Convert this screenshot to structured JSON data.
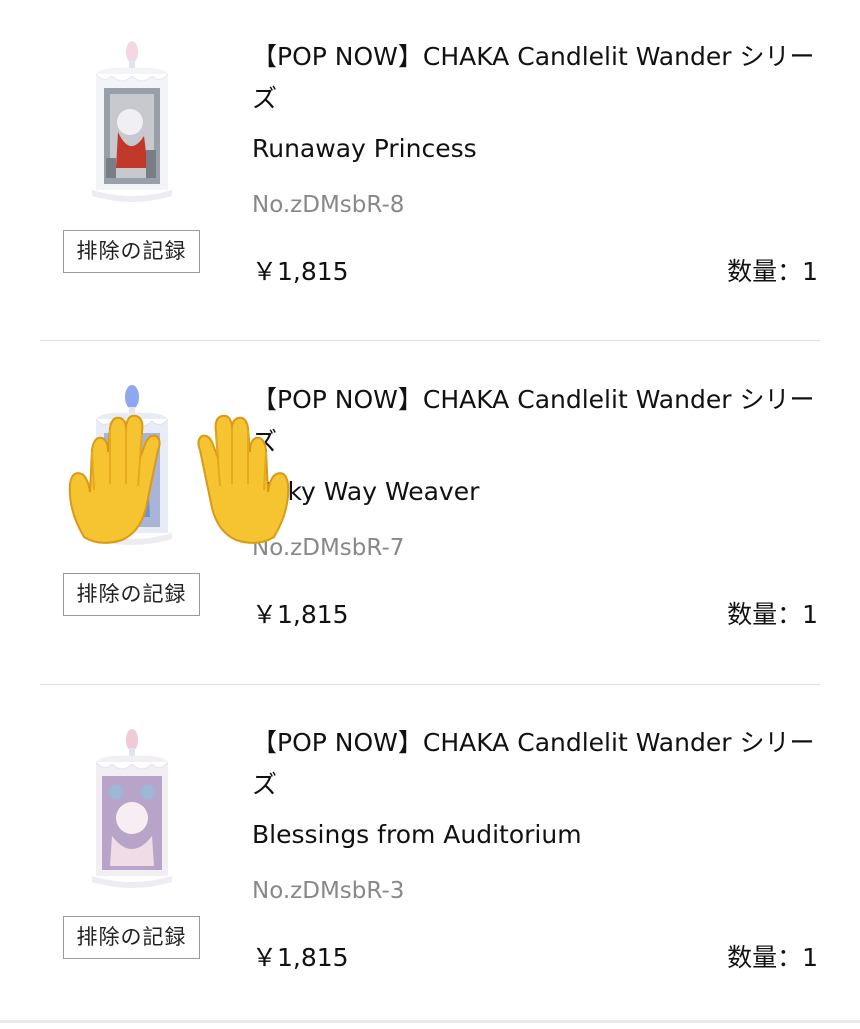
{
  "items": [
    {
      "title": "【POP NOW】CHAKA Candlelit Wander シリーズ",
      "variant": "Runaway Princess",
      "sku": "No.zDMsbR-8",
      "price": "￥1,815",
      "quantity": "数量：1",
      "remove_label": "排除の記録",
      "accent": "#c0392b"
    },
    {
      "title": "【POP NOW】CHAKA Candlelit Wander シリーズ",
      "variant": "Milky Way Weaver",
      "sku": "No.zDMsbR-7",
      "price": "￥1,815",
      "quantity": "数量：1",
      "remove_label": "排除の記録",
      "accent": "#6f8fd8"
    },
    {
      "title": "【POP NOW】CHAKA Candlelit Wander シリーズ",
      "variant": "Blessings from Auditorium",
      "sku": "No.zDMsbR-3",
      "price": "￥1,815",
      "quantity": "数量：1",
      "remove_label": "排除の記録",
      "accent": "#b7a4c8"
    }
  ],
  "overlay": {
    "icon": "raised-hands-emoji-icon"
  }
}
